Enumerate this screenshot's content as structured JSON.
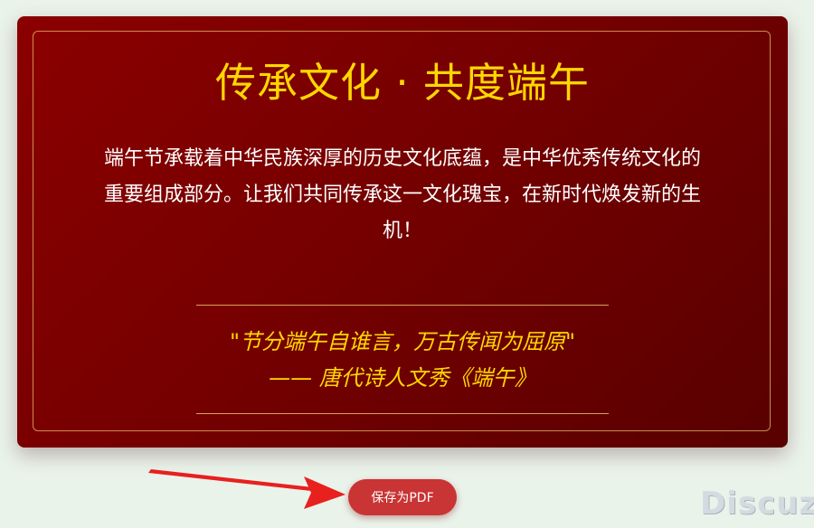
{
  "card": {
    "title": "传承文化 · 共度端午",
    "description": "端午节承载着中华民族深厚的历史文化底蕴，是中华优秀传统文化的重要组成部分。让我们共同传承这一文化瑰宝，在新时代焕发新的生机！",
    "quote_line1": "\"节分端午自谁言，万古传闻为屈原\"",
    "quote_line2": "—— 唐代诗人文秀《端午》"
  },
  "actions": {
    "save_pdf_label": "保存为PDF"
  },
  "watermark": {
    "text": "Discuz!"
  },
  "colors": {
    "card_primary": "#8b0000",
    "title_gold": "#ffd700",
    "button_red": "#c93434",
    "arrow_red": "#e8201e"
  }
}
